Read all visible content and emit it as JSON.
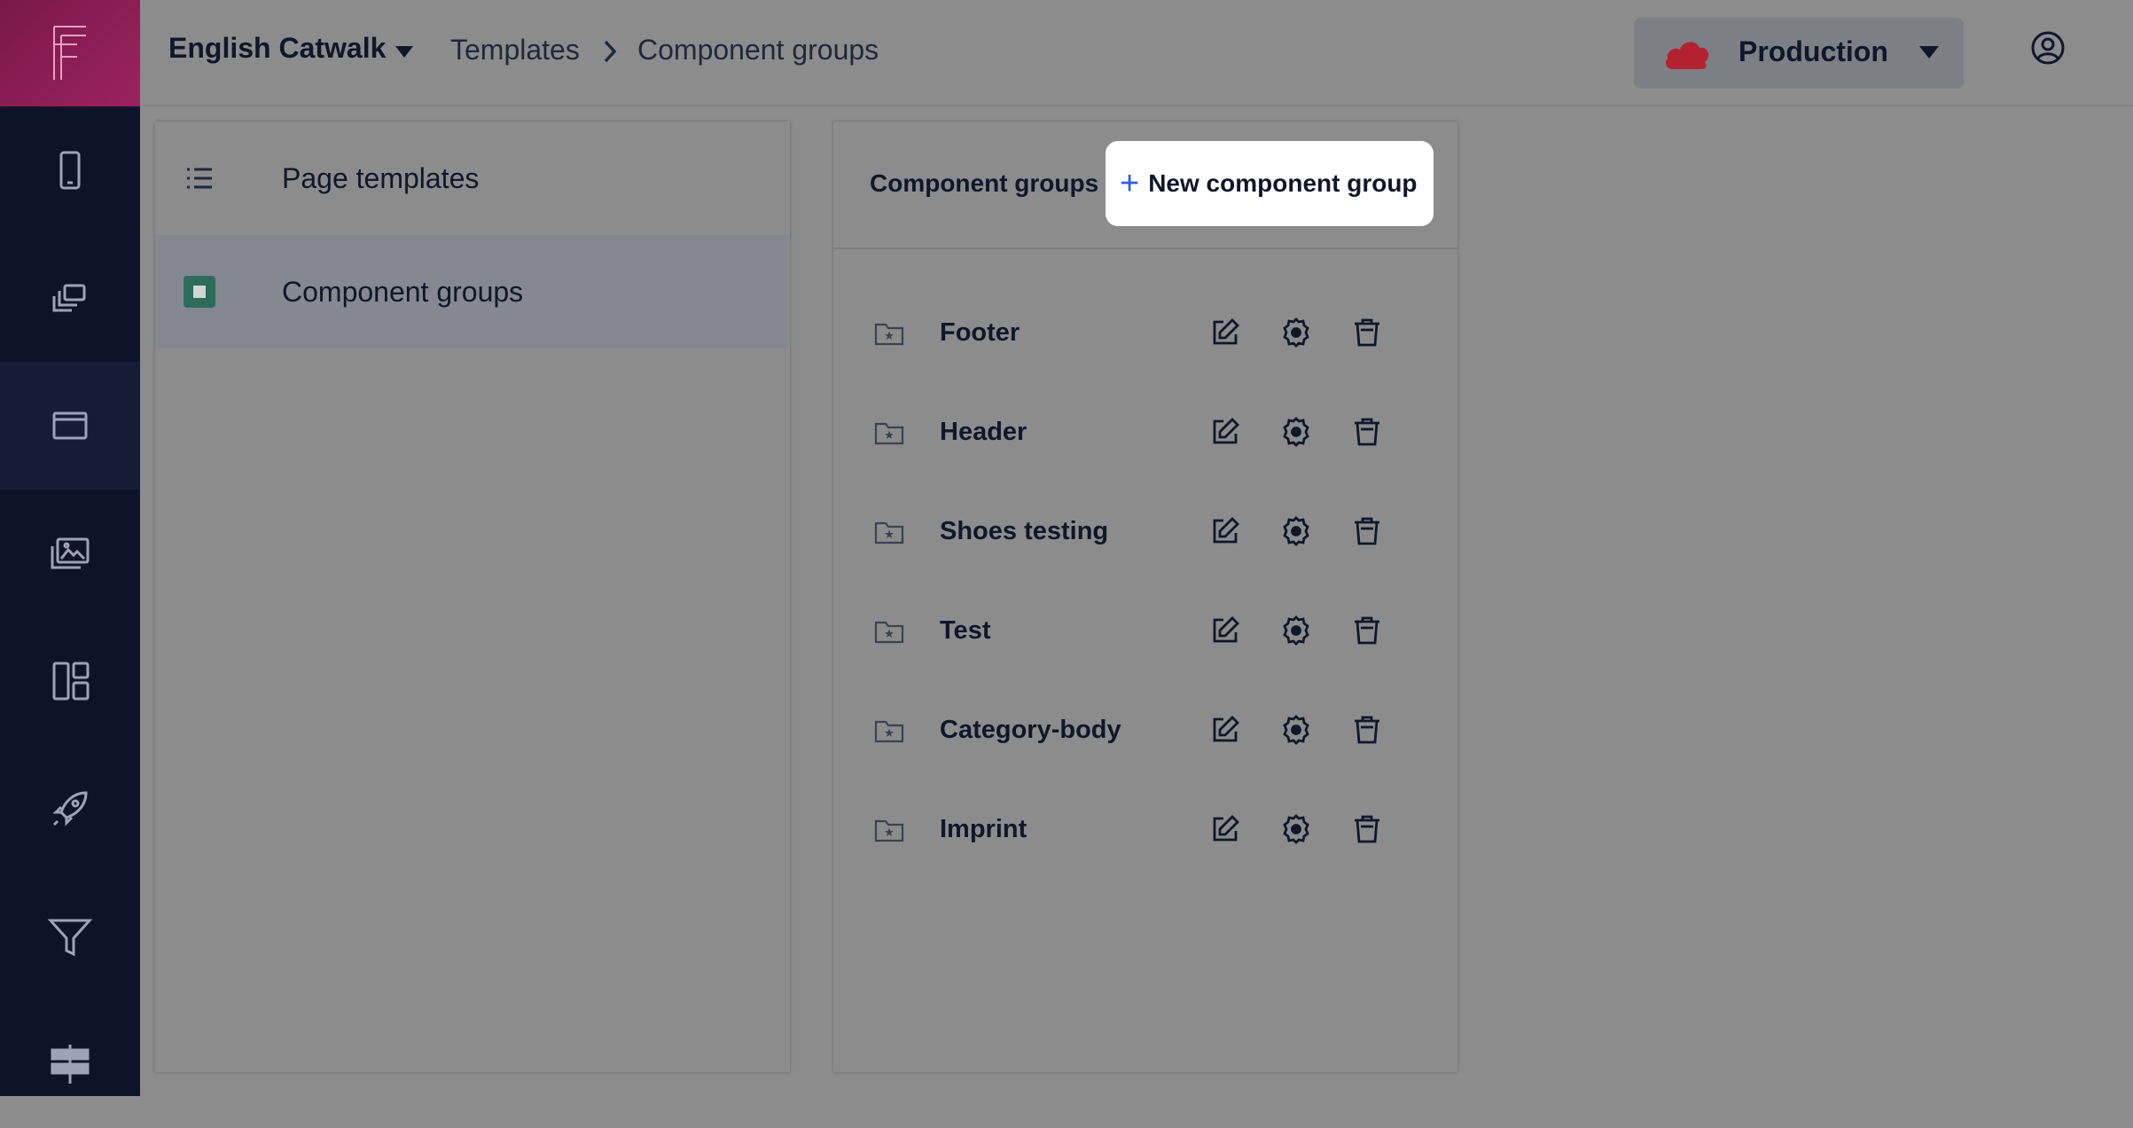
{
  "header": {
    "project": "English Catwalk",
    "breadcrumb": [
      "Templates",
      "Component groups"
    ],
    "environment": "Production"
  },
  "nav": {
    "icons": [
      "logo-icon",
      "mobile-icon",
      "pages-icon",
      "window-icon",
      "images-icon",
      "layout-icon",
      "rocket-icon",
      "filter-icon",
      "signpost-icon"
    ],
    "active": "window-icon"
  },
  "left_panel": {
    "items": [
      {
        "label": "Page templates"
      },
      {
        "label": "Component groups",
        "active": true
      }
    ]
  },
  "right_panel": {
    "title": "Component groups",
    "new_button": "New component group",
    "groups": [
      {
        "name": "Footer"
      },
      {
        "name": "Header"
      },
      {
        "name": "Shoes testing"
      },
      {
        "name": "Test"
      },
      {
        "name": "Category-body"
      },
      {
        "name": "Imprint"
      }
    ]
  },
  "colors": {
    "rail": "#0d1428",
    "logo_gradient": "#9a2360",
    "overlay": "#8c8c8d",
    "accent": "#2f5bea",
    "cloud": "#b3222f",
    "active_template_icon": "#2e6b5a"
  }
}
